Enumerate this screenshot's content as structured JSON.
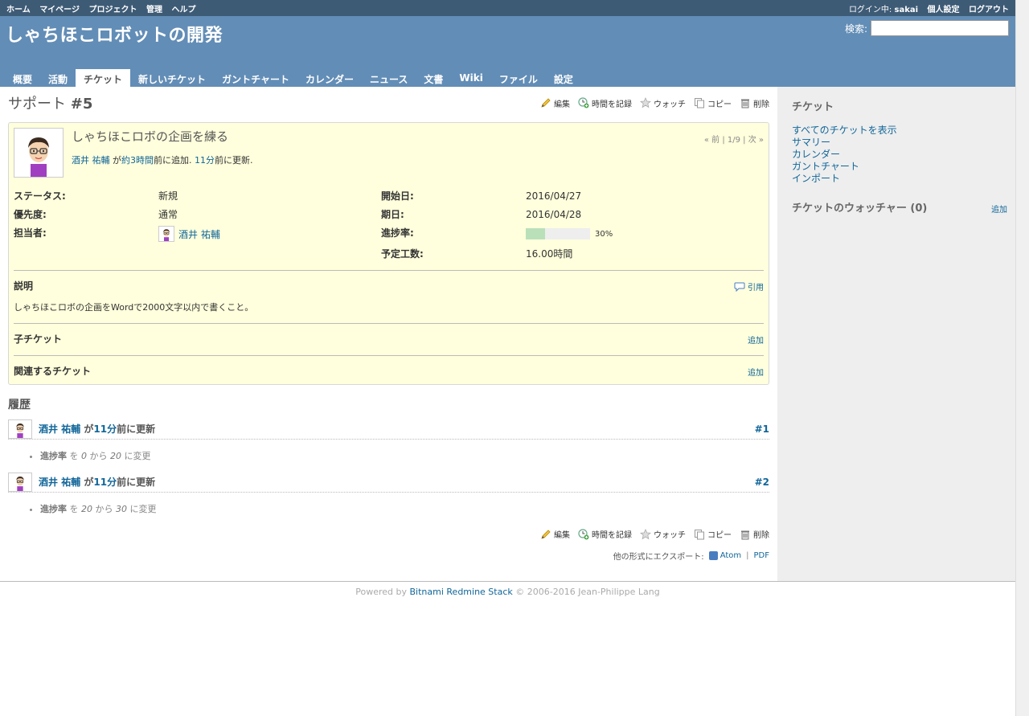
{
  "top_menu": {
    "left": [
      "ホーム",
      "マイページ",
      "プロジェクト",
      "管理",
      "ヘルプ"
    ],
    "logged_as_label": "ログイン中:",
    "user": "sakai",
    "my_account": "個人設定",
    "logout": "ログアウト"
  },
  "header": {
    "project_title": "しゃちほこロボットの開発",
    "search_label": "検索:",
    "search_value": ""
  },
  "main_menu": {
    "tabs": [
      "概要",
      "活動",
      "チケット",
      "新しいチケット",
      "ガントチャート",
      "カレンダー",
      "ニュース",
      "文書",
      "Wiki",
      "ファイル",
      "設定"
    ],
    "selected_index": 2
  },
  "actions": {
    "edit": "編集",
    "log_time": "時間を記録",
    "watch": "ウォッチ",
    "copy": "コピー",
    "delete": "削除"
  },
  "issue": {
    "tracker": "サポート",
    "number": "#5",
    "subject": "しゃちほこロボの企画を練る",
    "author": "酒井 祐輔",
    "author_text_1": "が",
    "added_ago": "約3時間",
    "author_text_2": "前に追加.",
    "updated_ago": "11分",
    "author_text_3": "前に更新.",
    "nav": {
      "prev": "« 前",
      "position": "1/9",
      "next": "次 »"
    },
    "attributes": {
      "status_label": "ステータス:",
      "status": "新規",
      "priority_label": "優先度:",
      "priority": "通常",
      "assignee_label": "担当者:",
      "assignee": "酒井 祐輔",
      "start_label": "開始日:",
      "start": "2016/04/27",
      "due_label": "期日:",
      "due": "2016/04/28",
      "progress_label": "進捗率:",
      "progress_pct": 30,
      "progress_text": "30%",
      "estimated_label": "予定工数:",
      "estimated": "16.00時間"
    },
    "description_label": "説明",
    "quote": "引用",
    "description": "しゃちほこロボの企画をWordで2000文字以内で書くこと。",
    "subtasks_label": "子チケット",
    "relations_label": "関連するチケット",
    "add": "追加"
  },
  "history": {
    "title": "履歴",
    "journals": [
      {
        "user": "酒井 祐輔",
        "text_a": "が",
        "ago": "11分",
        "text_b": "前に更新",
        "num": "#1",
        "field": "進捗率",
        "from_word": "を",
        "from": "0",
        "to_word": "から",
        "to": "20",
        "changed": "に変更"
      },
      {
        "user": "酒井 祐輔",
        "text_a": "が",
        "ago": "11分",
        "text_b": "前に更新",
        "num": "#2",
        "field": "進捗率",
        "from_word": "を",
        "from": "20",
        "to_word": "から",
        "to": "30",
        "changed": "に変更"
      }
    ]
  },
  "export": {
    "label": "他の形式にエクスポート:",
    "atom": "Atom",
    "pdf": "PDF"
  },
  "sidebar": {
    "title": "チケット",
    "links": [
      "すべてのチケットを表示",
      "サマリー",
      "カレンダー",
      "ガントチャート",
      "インポート"
    ],
    "watchers": "チケットのウォッチャー (0)",
    "add": "追加"
  },
  "footer": {
    "powered_by": "Powered by",
    "product": "Bitnami Redmine Stack",
    "copyright": "© 2006-2016 Jean-Philippe Lang"
  },
  "colors": {
    "top_menu": "#3e5b76",
    "header": "#628db6",
    "issue_bg": "#ffffdd",
    "link": "#116699",
    "progress_done": "#bae0ba"
  }
}
